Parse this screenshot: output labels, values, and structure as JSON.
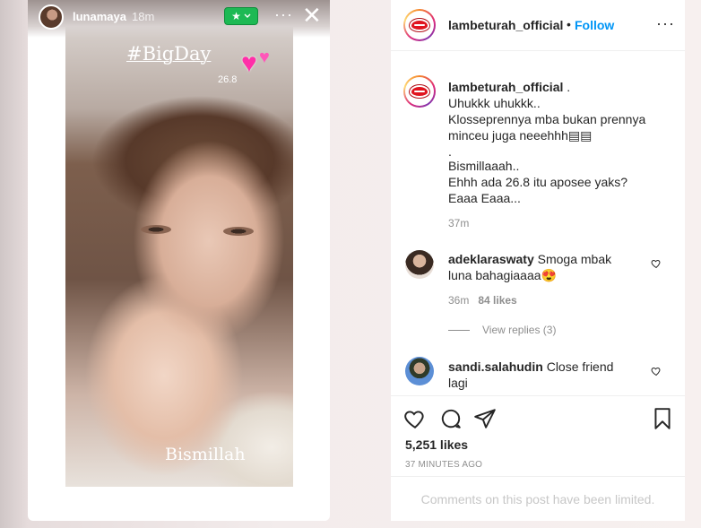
{
  "story": {
    "username": "lunamaya",
    "time": "18m",
    "close_friends_badge": "★",
    "more": "···",
    "close": "✕",
    "sticker_title": "#BigDay",
    "sticker_date": "26.8",
    "bottom_text": "Bismillah",
    "hearts_icon": "heart-sticker-icon"
  },
  "post": {
    "header": {
      "username": "lambeturah_official",
      "separator": "•",
      "follow_label": "Follow",
      "more": "···"
    },
    "caption": {
      "username": "lambeturah_official",
      "suffix": ".",
      "lines": [
        "Uhukkk uhukkk..",
        "Klosseprennya mba bukan prennya",
        "minceu juga neeehhh▤▤",
        ".",
        "Bismillaaah..",
        "Ehhh ada 26.8 itu aposee yaks?",
        "Eaaa Eaaa..."
      ],
      "time": "37m"
    },
    "comments": [
      {
        "username": "adeklaraswaty",
        "text": "Smoga mbak luna bahagiaaaa😍",
        "time": "36m",
        "likes": "84 likes",
        "view_replies": "View replies (3)"
      },
      {
        "username": "sandi.salahudin",
        "text": "Close friend lagi"
      }
    ],
    "likes": "5,251 likes",
    "ago": "37 MINUTES AGO",
    "limited": "Comments on this post have been limited."
  },
  "colors": {
    "follow": "#0095f6",
    "badge": "#1db954",
    "muted": "#8e8e8e",
    "lips": "#e0141f"
  }
}
